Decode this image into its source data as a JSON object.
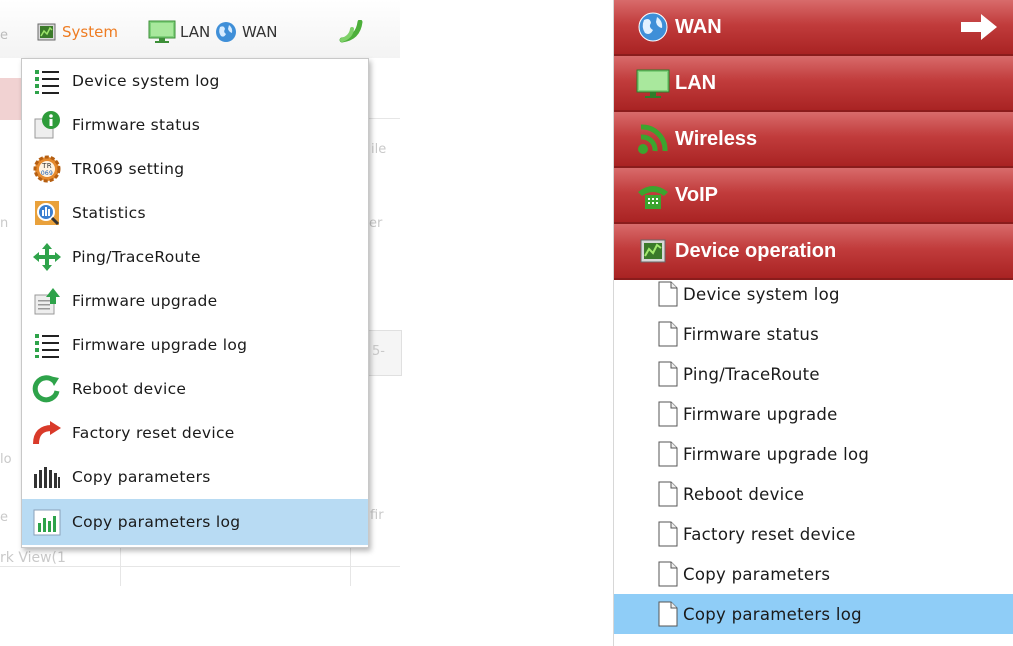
{
  "left_panel": {
    "topbar": {
      "system_label": "System",
      "lan_label": "LAN",
      "wan_label": "WAN"
    },
    "dropdown": {
      "items": [
        {
          "label": "Device system log",
          "icon": "list-icon"
        },
        {
          "label": "Firmware status",
          "icon": "info-icon"
        },
        {
          "label": "TR069 setting",
          "icon": "tr069-icon"
        },
        {
          "label": "Statistics",
          "icon": "statistics-icon"
        },
        {
          "label": "Ping/TraceRoute",
          "icon": "arrows-icon"
        },
        {
          "label": "Firmware upgrade",
          "icon": "upload-icon"
        },
        {
          "label": "Firmware upgrade log",
          "icon": "list-icon"
        },
        {
          "label": "Reboot device",
          "icon": "reboot-icon"
        },
        {
          "label": "Factory reset device",
          "icon": "reset-arrow-icon"
        },
        {
          "label": "Copy parameters",
          "icon": "bars-icon"
        },
        {
          "label": "Copy parameters log",
          "icon": "chart-icon"
        }
      ],
      "selected": "Copy parameters log"
    }
  },
  "right_panel": {
    "categories": [
      {
        "label": "WAN",
        "icon": "globe-icon"
      },
      {
        "label": "LAN",
        "icon": "monitor-icon"
      },
      {
        "label": "Wireless",
        "icon": "wifi-icon"
      },
      {
        "label": "VoIP",
        "icon": "phone-icon"
      },
      {
        "label": "Device operation",
        "icon": "device-operation-icon"
      }
    ],
    "submenu": [
      "Device system log",
      "Firmware status",
      "Ping/TraceRoute",
      "Firmware upgrade",
      "Firmware upgrade log",
      "Reboot device",
      "Factory reset device",
      "Copy parameters",
      "Copy parameters log"
    ],
    "selected": "Copy parameters log"
  },
  "colors": {
    "system_accent": "#ee7c22",
    "selected_left": "#b8dbf3",
    "selected_right": "#8fcdf7",
    "category_red": "#b83030"
  }
}
